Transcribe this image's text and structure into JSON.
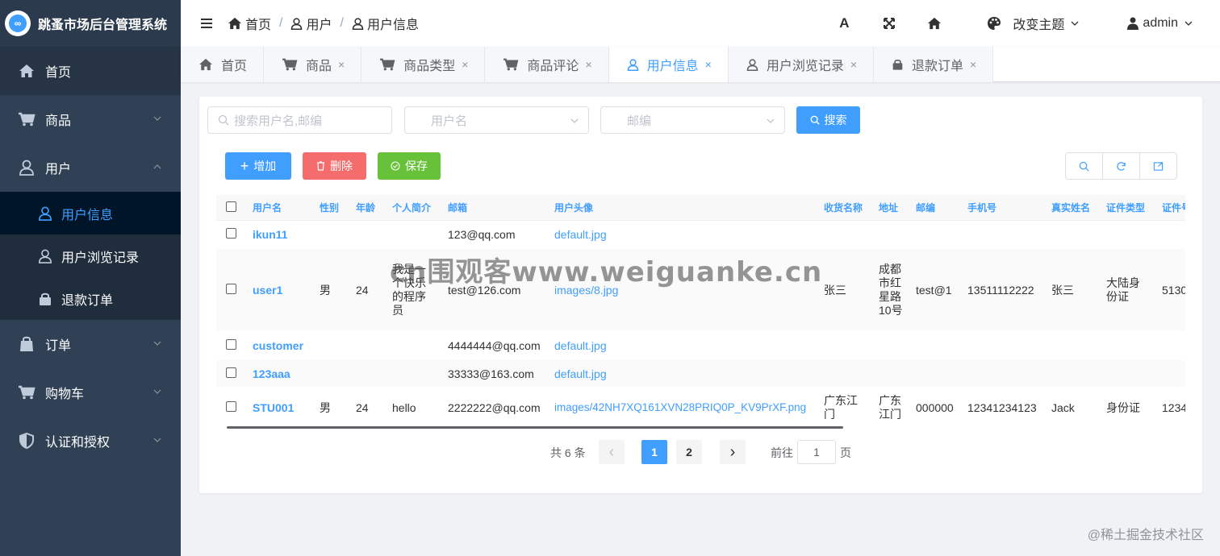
{
  "app": {
    "title": "跳蚤市场后台管理系统",
    "logo_text": "∞"
  },
  "sidebar": {
    "items": [
      {
        "label": "首页",
        "icon": "home-icon"
      },
      {
        "label": "商品",
        "icon": "cart-icon"
      },
      {
        "label": "用户",
        "icon": "user-icon"
      },
      {
        "label": "订单",
        "icon": "bag-icon"
      },
      {
        "label": "购物车",
        "icon": "cart-icon"
      },
      {
        "label": "认证和授权",
        "icon": "shield-icon"
      }
    ],
    "user_sub": [
      {
        "label": "用户信息",
        "icon": "user-icon"
      },
      {
        "label": "用户浏览记录",
        "icon": "user-icon"
      },
      {
        "label": "退款订单",
        "icon": "lock-icon"
      }
    ]
  },
  "navbar": {
    "breadcrumb": [
      "首页",
      "用户",
      "用户信息"
    ],
    "separator": "/",
    "theme_label": "改变主题",
    "user_label": "admin",
    "font_icon_text": "A"
  },
  "tabs": [
    {
      "label": "首页",
      "closable": false
    },
    {
      "label": "商品",
      "closable": true
    },
    {
      "label": "商品类型",
      "closable": true
    },
    {
      "label": "商品评论",
      "closable": true
    },
    {
      "label": "用户信息",
      "closable": true,
      "active": true
    },
    {
      "label": "用户浏览记录",
      "closable": true
    },
    {
      "label": "退款订单",
      "closable": true
    }
  ],
  "tab_close": "×",
  "filters": {
    "search_placeholder": "搜索用户名,邮编",
    "username_placeholder": "用户名",
    "zip_placeholder": "邮编",
    "search_button": "搜索"
  },
  "actions": {
    "add": "增加",
    "delete": "删除",
    "save": "保存"
  },
  "table": {
    "headers": [
      "用户名",
      "性别",
      "年龄",
      "个人简介",
      "邮箱",
      "用户头像",
      "收货名称",
      "地址",
      "邮编",
      "手机号",
      "真实姓名",
      "证件类型",
      "证件号"
    ],
    "rows": [
      {
        "username": "ikun11",
        "gender": "",
        "age": "",
        "bio": "",
        "email": "123@qq.com",
        "avatar": "default.jpg",
        "receiver": "",
        "address": "",
        "zip": "",
        "phone": "",
        "realname": "",
        "idtype": "",
        "idno": ""
      },
      {
        "username": "user1",
        "gender": "男",
        "age": "24",
        "bio": "我是一个快乐的程序员",
        "email": "test@126.com",
        "avatar": "images/8.jpg",
        "receiver": "张三",
        "address": "成都市红星路10号",
        "zip": "test@1",
        "phone": "13511112222",
        "realname": "张三",
        "idtype": "大陆身份证",
        "idno": "5130"
      },
      {
        "username": "customer",
        "gender": "",
        "age": "",
        "bio": "",
        "email": "4444444@qq.com",
        "avatar": "default.jpg",
        "receiver": "",
        "address": "",
        "zip": "",
        "phone": "",
        "realname": "",
        "idtype": "",
        "idno": ""
      },
      {
        "username": "123aaa",
        "gender": "",
        "age": "",
        "bio": "",
        "email": "33333@163.com",
        "avatar": "default.jpg",
        "receiver": "",
        "address": "",
        "zip": "",
        "phone": "",
        "realname": "",
        "idtype": "",
        "idno": ""
      },
      {
        "username": "STU001",
        "gender": "男",
        "age": "24",
        "bio": "hello",
        "email": "2222222@qq.com",
        "avatar": "images/42NH7XQ161XVN28PRIQ0P_KV9PrXF.png",
        "receiver": "广东江门",
        "address": "广东江门",
        "zip": "000000",
        "phone": "12341234123",
        "realname": "Jack",
        "idtype": "身份证",
        "idno": "1234"
      }
    ]
  },
  "pagination": {
    "total_text": "共 6 条",
    "pages": [
      "1",
      "2"
    ],
    "current": "1",
    "goto_label": "前往",
    "goto_value": "1",
    "page_suffix": "页",
    "prev": "‹",
    "next": "›"
  },
  "watermark": "cn围观客www.weiguanke.cn",
  "credit": "@稀土掘金技术社区",
  "colors": {
    "primary": "#409eff",
    "danger": "#f56c6c",
    "success": "#67c23a",
    "sidebar": "#304156"
  }
}
